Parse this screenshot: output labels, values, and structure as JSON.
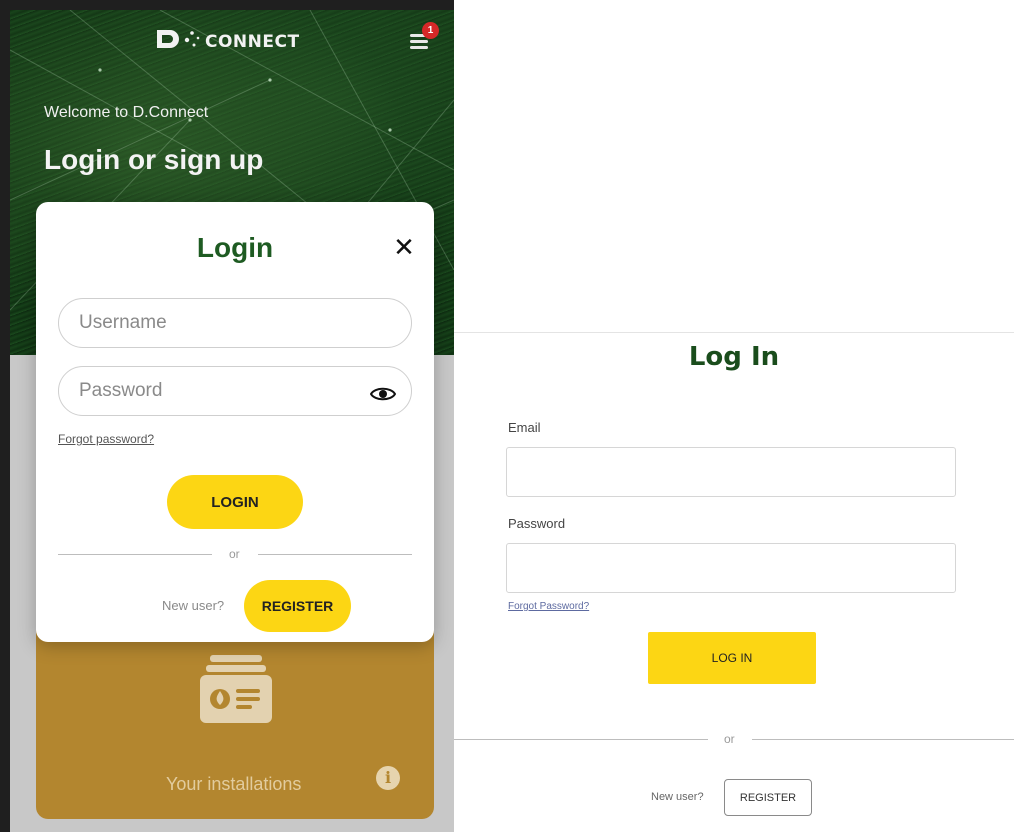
{
  "mobile": {
    "brand": "D CONNECT",
    "notification_count": "1",
    "welcome": "Welcome to D.Connect",
    "hero_title": "Login or sign up",
    "modal": {
      "title": "Login",
      "username_placeholder": "Username",
      "password_placeholder": "Password",
      "forgot_password": "Forgot password?",
      "login_button": "LOGIN",
      "or": "or",
      "new_user": "New user?",
      "register_button": "REGISTER"
    },
    "card": {
      "label": "Your installations"
    }
  },
  "desktop": {
    "title": "Log In",
    "email_label": "Email",
    "password_label": "Password",
    "forgot_password": "Forgot Password?",
    "login_button": "LOG IN",
    "or": "or",
    "new_user": "New user?",
    "register_button": "REGISTER"
  },
  "colors": {
    "brand_green": "#1e5b22",
    "accent_yellow": "#fcd614",
    "card_gold": "#b3862f",
    "notification_red": "#d62828"
  },
  "icons": [
    "menu-icon",
    "close-icon",
    "eye-icon",
    "installation-icon",
    "info-icon"
  ]
}
